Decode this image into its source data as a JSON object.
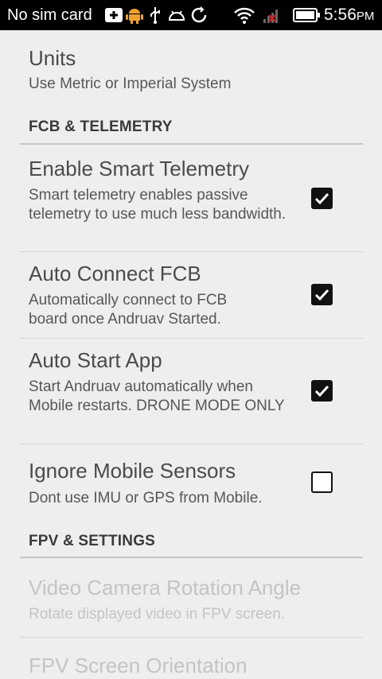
{
  "status_bar": {
    "carrier": "No sim card",
    "time": "5:56",
    "ampm": "PM",
    "icons": [
      "add-notification-icon",
      "android-icon",
      "usb-icon",
      "android-debug-icon",
      "sync-icon",
      "wifi-icon",
      "signal-no-sim-icon",
      "battery-icon"
    ]
  },
  "prefs": {
    "units": {
      "title": "Units",
      "summary": "Use Metric or Imperial System"
    },
    "fcb_category": "FCB & TELEMETRY",
    "smart_telemetry": {
      "title": "Enable Smart Telemetry",
      "summary": "Smart telemetry enables passive telemetry to use much less bandwidth.",
      "checked": true
    },
    "auto_connect": {
      "title": "Auto Connect FCB",
      "summary": "Automatically connect to FCB board once Andruav Started.",
      "checked": true
    },
    "auto_start": {
      "title": "Auto Start App",
      "summary": "Start Andruav automatically when Mobile restarts. DRONE MODE ONLY",
      "checked": true
    },
    "ignore_sensors": {
      "title": "Ignore Mobile Sensors",
      "summary": "Dont use IMU or GPS from Mobile.",
      "checked": false
    },
    "fpv_category": "FPV & SETTINGS",
    "video_rotation": {
      "title": "Video Camera Rotation Angle",
      "summary": "Rotate displayed video in FPV screen.",
      "enabled": false
    },
    "fpv_orientation": {
      "title": "FPV Screen Orientation",
      "enabled": false
    }
  },
  "colors": {
    "status_bar": "#000000",
    "background": "#eeeeee",
    "disabled_text": "#c4c4c4",
    "checkbox": "#111111"
  }
}
